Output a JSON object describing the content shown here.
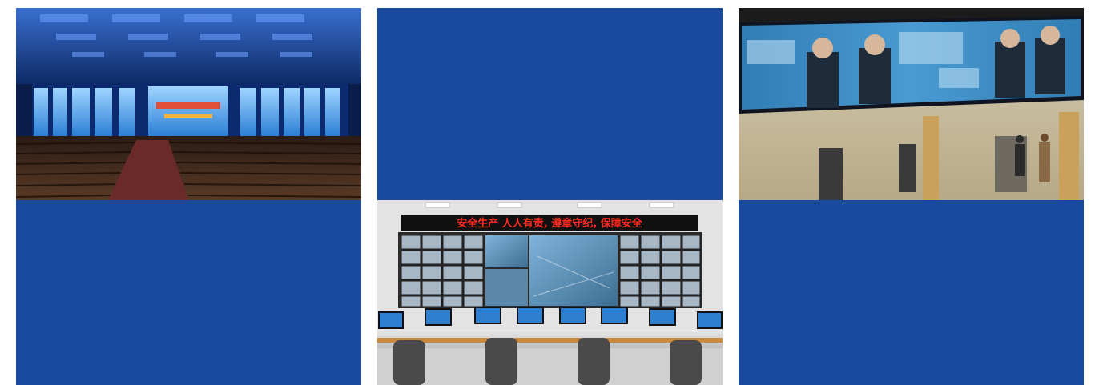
{
  "gallery": {
    "tiles": [
      {
        "id": "conference-hall",
        "kind": "photo"
      },
      {
        "id": "blue-panel-top",
        "kind": "color",
        "color": "#1a49a0"
      },
      {
        "id": "video-wall-lobby",
        "kind": "photo"
      },
      {
        "id": "blue-panel-bottom-left",
        "kind": "color",
        "color": "#1a49a0"
      },
      {
        "id": "control-room",
        "kind": "photo",
        "led_banner": "安全生产  人人有责, 遵章守纪, 保障安全"
      },
      {
        "id": "blue-panel-bottom-right",
        "kind": "color",
        "color": "#1a49a0"
      }
    ]
  }
}
